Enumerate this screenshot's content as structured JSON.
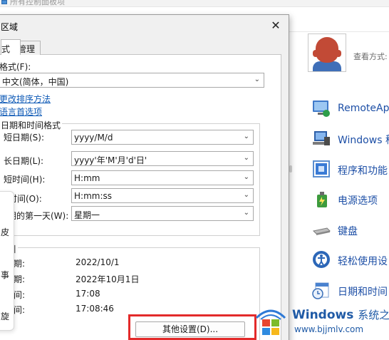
{
  "control_panel": {
    "breadcrumb": "所有控制面板项",
    "view_by": "查看方式:",
    "items": [
      {
        "label": "RemoteApp",
        "icon": "remoteapp-icon"
      },
      {
        "label": "Windows 移",
        "icon": "windows-mobility-icon"
      },
      {
        "label": "程序和功能",
        "icon": "programs-features-icon"
      },
      {
        "label": "电源选项",
        "icon": "power-options-icon"
      },
      {
        "label": "键盘",
        "icon": "keyboard-icon"
      },
      {
        "label": "轻松使用设",
        "icon": "ease-of-access-icon"
      },
      {
        "label": "日期和时间",
        "icon": "date-time-icon"
      }
    ]
  },
  "dialog": {
    "title": "区域",
    "close": "✕",
    "tabs": [
      {
        "label": "式"
      },
      {
        "label": "管理"
      }
    ],
    "format_label": "格式(F):",
    "format_value": "中文(简体，中国)",
    "links": {
      "sort": "更改排序方法",
      "language": "语言首选项"
    },
    "group_title": "日期和时间格式",
    "rows": [
      {
        "label": "短日期(S):",
        "value": "yyyy/M/d"
      },
      {
        "label": "长日期(L):",
        "value": "yyyy'年'M'月'd'日'"
      },
      {
        "label": "短时间(H):",
        "value": "H:mm"
      },
      {
        "label": "时间(O):",
        "value": "H:mm:ss"
      },
      {
        "label": "期的第一天(W):",
        "value": "星期一"
      }
    ],
    "example_title": "引",
    "examples": [
      {
        "label": "日期:",
        "value": "2022/10/1"
      },
      {
        "label": "日期:",
        "value": "2022年10月1日"
      },
      {
        "label": "时间:",
        "value": "17:08"
      },
      {
        "label": "时间:",
        "value": "17:08:46"
      }
    ],
    "other_settings": "其他设置(D)..."
  },
  "side_card": {
    "chars": [
      "皮",
      "事",
      "旋"
    ]
  },
  "watermark": {
    "title": "Windows",
    "title_cn": "系统之家",
    "url": "www.bjjmlv.com"
  }
}
